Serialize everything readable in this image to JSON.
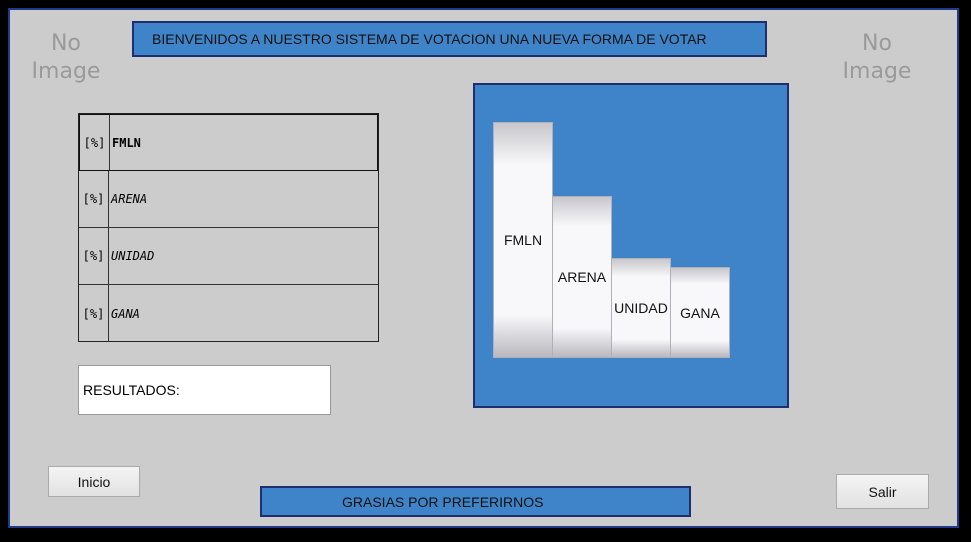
{
  "placeholders": {
    "left_image": "No Image",
    "right_image": "No Image"
  },
  "header": {
    "banner_text": "BIENVENIDOS A NUESTRO SISTEMA DE VOTACION UNA NUEVA FORMA DE VOTAR"
  },
  "parties_table": {
    "rows": [
      {
        "pct": "[%]",
        "name": "FMLN"
      },
      {
        "pct": "[%]",
        "name": "ARENA"
      },
      {
        "pct": "[%]",
        "name": "UNIDAD"
      },
      {
        "pct": "[%]",
        "name": "GANA"
      }
    ]
  },
  "results": {
    "label": "RESULTADOS:"
  },
  "chart_data": {
    "type": "bar",
    "categories": [
      "FMLN",
      "ARENA",
      "UNIDAD",
      "GANA"
    ],
    "values": [
      236,
      162,
      100,
      91
    ],
    "ylim": [
      0,
      260
    ],
    "grid": false,
    "title": "",
    "xlabel": "",
    "ylabel": ""
  },
  "footer": {
    "banner_text": "GRASIAS POR PREFERIRNOS"
  },
  "buttons": {
    "inicio": "Inicio",
    "salir": "Salir"
  },
  "colors": {
    "background": "#cccccc",
    "accent": "#3f84c8",
    "border": "#1f2e6e"
  }
}
